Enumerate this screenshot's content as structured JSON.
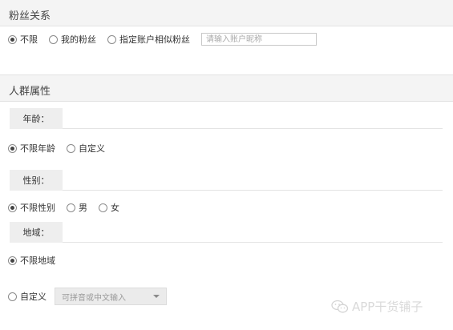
{
  "fans_section": {
    "title": "粉丝关系",
    "options": [
      {
        "label": "不限",
        "checked": true
      },
      {
        "label": "我的粉丝",
        "checked": false
      },
      {
        "label": "指定账户相似粉丝",
        "checked": false
      }
    ],
    "account_input": {
      "placeholder": "请输入账户昵称",
      "value": ""
    }
  },
  "crowd_section": {
    "title": "人群属性",
    "age": {
      "label": "年龄：",
      "options": [
        {
          "label": "不限年龄",
          "checked": true
        },
        {
          "label": "自定义",
          "checked": false
        }
      ]
    },
    "gender": {
      "label": "性别：",
      "options": [
        {
          "label": "不限性别",
          "checked": true
        },
        {
          "label": "男",
          "checked": false
        },
        {
          "label": "女",
          "checked": false
        }
      ]
    },
    "region": {
      "label": "地域：",
      "options": [
        {
          "label": "不限地域",
          "checked": true
        },
        {
          "label": "自定义",
          "checked": false
        }
      ],
      "select": {
        "placeholder": "可拼音或中文输入"
      }
    }
  },
  "watermark": {
    "text": "APP干货铺子",
    "icon": "wechat-icon"
  }
}
